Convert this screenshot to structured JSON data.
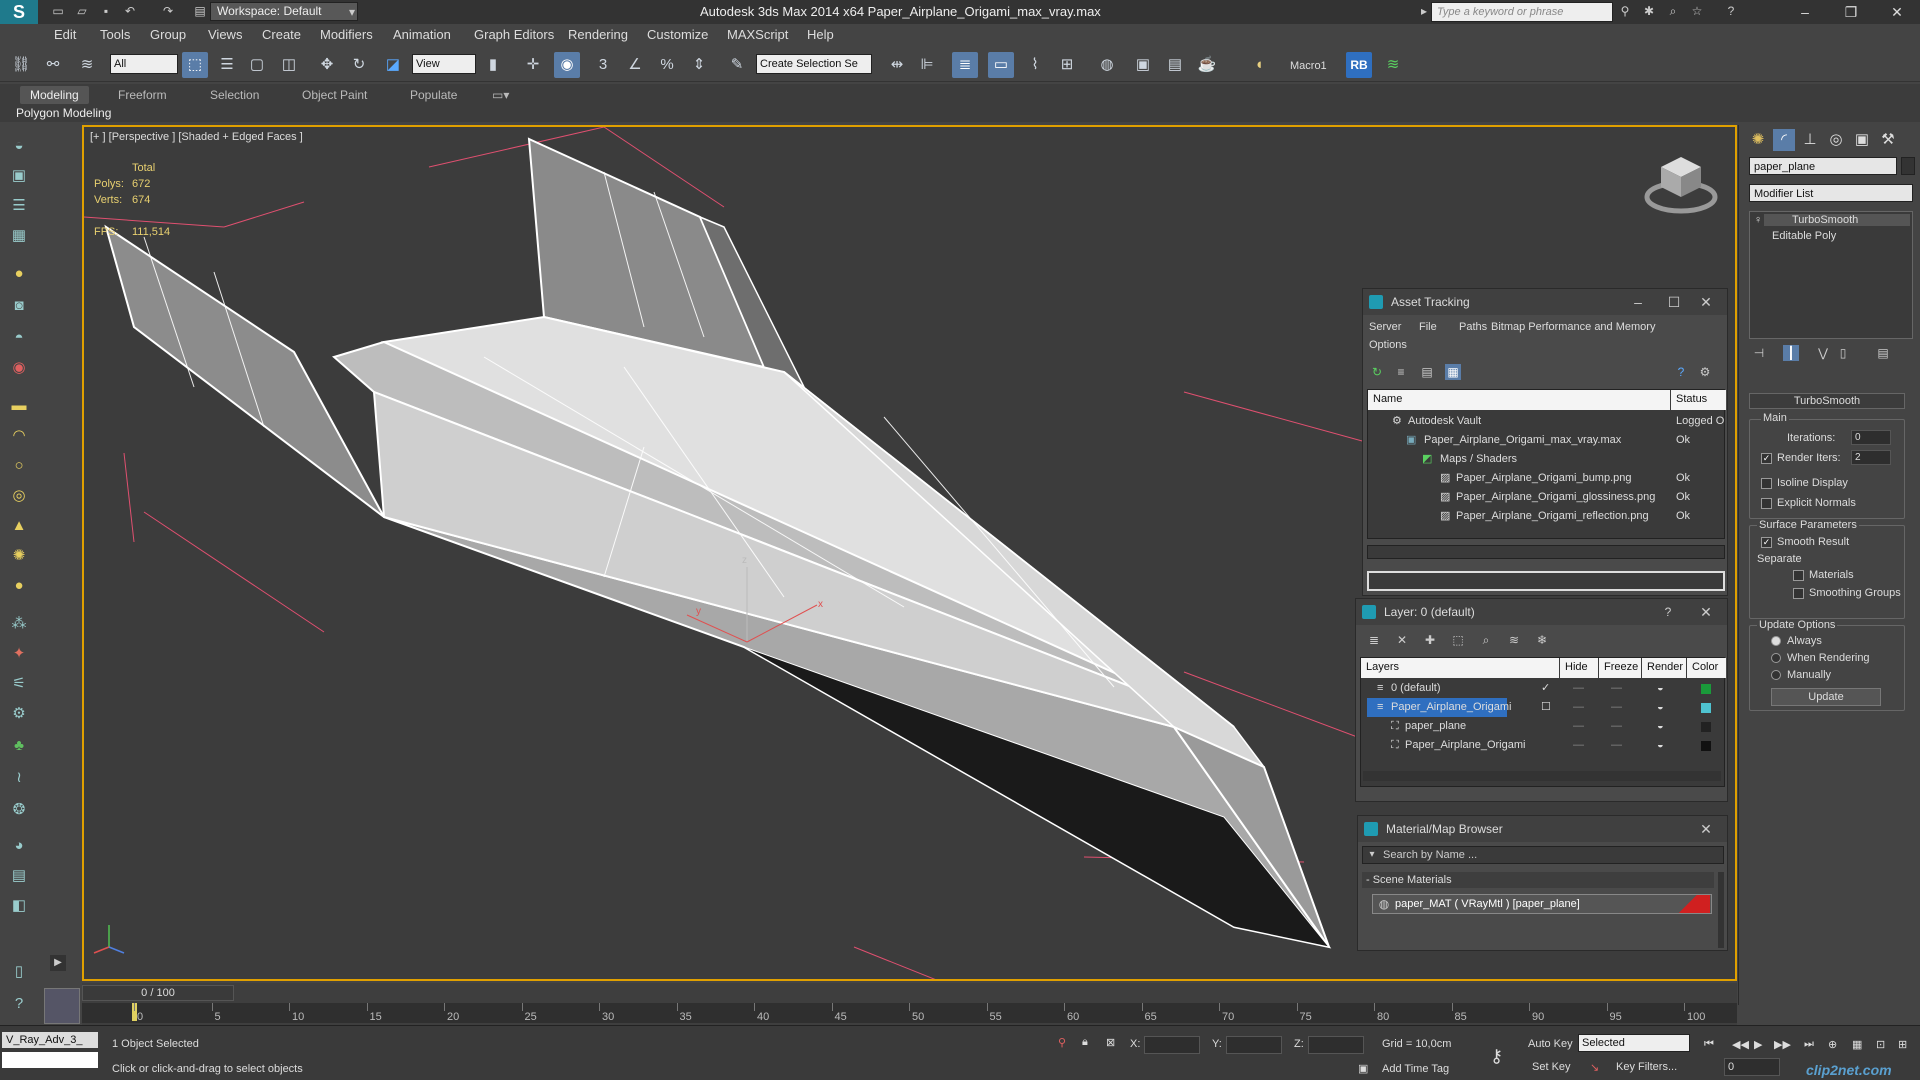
{
  "title_bar": {
    "workspace": "Workspace: Default",
    "app_title": "Autodesk 3ds Max  2014 x64     Paper_Airplane_Origami_max_vray.max",
    "search_placeholder": "Type a keyword or phrase"
  },
  "menu": [
    "Edit",
    "Tools",
    "Group",
    "Views",
    "Create",
    "Modifiers",
    "Animation",
    "Graph Editors",
    "Rendering",
    "Customize",
    "MAXScript",
    "Help"
  ],
  "toolbar": {
    "filter": "All",
    "view": "View",
    "selection_set": "Create Selection Se",
    "macro": "Macro1",
    "rb": "RB"
  },
  "ribbon": {
    "tabs": [
      "Modeling",
      "Freeform",
      "Selection",
      "Object Paint",
      "Populate"
    ],
    "active": "Modeling",
    "sub_label": "Polygon Modeling"
  },
  "viewport": {
    "label": "[+ ] [Perspective ] [Shaded + Edged Faces ]",
    "stats": {
      "total_label": "Total",
      "polys_label": "Polys:",
      "polys": "672",
      "verts_label": "Verts:",
      "verts": "674",
      "fps_label": "FPS:",
      "fps": "111,514"
    }
  },
  "asset_tracking": {
    "title": "Asset Tracking",
    "menu": [
      "Server",
      "File",
      "Paths",
      "Bitmap Performance and Memory",
      "Options"
    ],
    "columns": [
      "Name",
      "Status"
    ],
    "rows": [
      {
        "name": "Autodesk Vault",
        "status": "Logged O"
      },
      {
        "name": "Paper_Airplane_Origami_max_vray.max",
        "status": "Ok"
      },
      {
        "name": "Maps / Shaders",
        "status": ""
      },
      {
        "name": "Paper_Airplane_Origami_bump.png",
        "status": "Ok"
      },
      {
        "name": "Paper_Airplane_Origami_glossiness.png",
        "status": "Ok"
      },
      {
        "name": "Paper_Airplane_Origami_reflection.png",
        "status": "Ok"
      }
    ]
  },
  "layer_window": {
    "title": "Layer: 0 (default)",
    "help": "?",
    "columns": [
      "Layers",
      "Hide",
      "Freeze",
      "Render",
      "Color"
    ],
    "rows": [
      {
        "name": "0 (default)",
        "color": "#1a9a3a"
      },
      {
        "name": "Paper_Airplane_Origami",
        "color": "#4fc3d0"
      },
      {
        "name": "paper_plane",
        "color": "#222222"
      },
      {
        "name": "Paper_Airplane_Origami",
        "color": "#111111"
      }
    ]
  },
  "material_browser": {
    "title": "Material/Map Browser",
    "search_placeholder": "Search by Name ...",
    "section": "- Scene Materials",
    "material": "paper_MAT  ( VRayMtl )  [paper_plane]"
  },
  "command_panel": {
    "object_name": "paper_plane",
    "modifier_list": "Modifier List",
    "stack": [
      "TurboSmooth",
      "Editable Poly"
    ],
    "turbosmooth": {
      "title": "TurboSmooth",
      "main": "Main",
      "iterations_label": "Iterations:",
      "iterations": "0",
      "render_iters_label": "Render Iters:",
      "render_iters": "2",
      "isoline": "Isoline Display",
      "explicit": "Explicit Normals",
      "surface": "Surface Parameters",
      "smooth_result": "Smooth Result",
      "separate": "Separate",
      "materials": "Materials",
      "smoothing_groups": "Smoothing Groups",
      "update_options": "Update Options",
      "always": "Always",
      "when_rendering": "When Rendering",
      "manually": "Manually",
      "update": "Update"
    }
  },
  "timeline": {
    "frame": "0 / 100",
    "ticks": [
      "0",
      "5",
      "10",
      "15",
      "20",
      "25",
      "30",
      "35",
      "40",
      "45",
      "50",
      "55",
      "60",
      "65",
      "70",
      "75",
      "80",
      "85",
      "90",
      "95",
      "100"
    ]
  },
  "status": {
    "script_box": "V_Ray_Adv_3_",
    "selected": "1 Object Selected",
    "prompt": "Click or click-and-drag to select objects",
    "x": "X:",
    "y": "Y:",
    "z": "Z:",
    "grid": "Grid = 10,0cm",
    "add_time_tag": "Add Time Tag",
    "auto_key": "Auto Key",
    "set_key": "Set Key",
    "key_mode": "Selected",
    "key_filters": "Key Filters...",
    "frame": "0",
    "watermark": "clip2net.com"
  }
}
